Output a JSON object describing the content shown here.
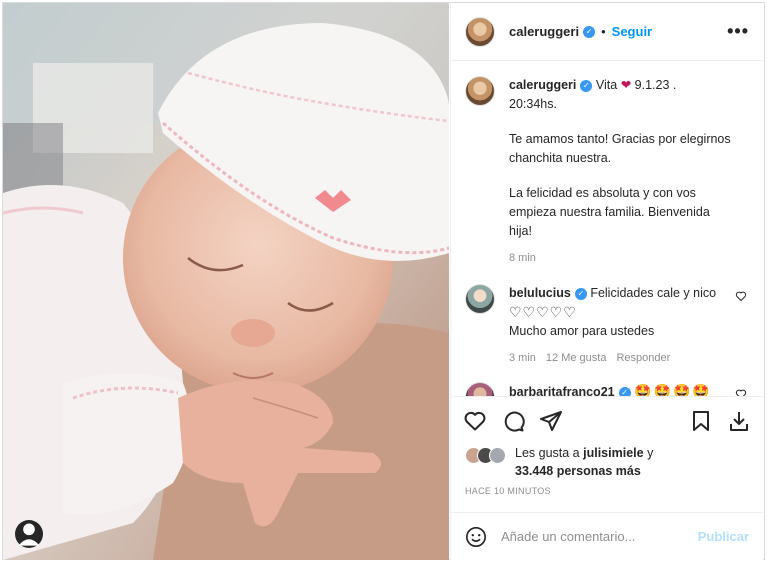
{
  "post": {
    "username": "caleruggeri",
    "follow_label": "Seguir",
    "separator": "•",
    "more_label": "•••"
  },
  "caption": {
    "username": "caleruggeri",
    "line1": "Vita",
    "line1_after": "9.1.23 .",
    "line2": "20:34hs.",
    "para1": "Te amamos tanto! Gracias por elegirnos chanchita nuestra.",
    "para2": "La felicidad es absoluta y con vos empieza nuestra familia. Bienvenida hija!",
    "time": "8 min"
  },
  "comments": [
    {
      "username": "belulucius",
      "text": "Felicidades cale y nico",
      "hearts": "♡♡♡♡♡",
      "text2": "Mucho amor para ustedes",
      "time": "3 min",
      "likes": "12 Me gusta",
      "reply": "Responder"
    },
    {
      "username": "barbaritafranco21",
      "emojis": "🤩🤩🤩🤩",
      "emojis2": "🤩🤩🤩"
    }
  ],
  "likes": {
    "prefix": "Les gusta a",
    "user": "julisimiele",
    "suffix": "y",
    "count": "33.448 personas más"
  },
  "timestamp": "HACE 10 MINUTOS",
  "add_comment": {
    "placeholder": "Añade un comentario...",
    "publish_label": "Publicar"
  },
  "colors": {
    "accent": "#0095f6",
    "publish_disabled": "#b2dffc",
    "muted": "#8e8e8e",
    "verified": "#3897f0",
    "heart_emoji": "#c2185b"
  },
  "icons": [
    "user-tag-icon",
    "verified-icon",
    "heart-icon",
    "comment-icon",
    "share-icon",
    "bookmark-icon",
    "download-icon",
    "emoji-icon",
    "more-icon"
  ]
}
